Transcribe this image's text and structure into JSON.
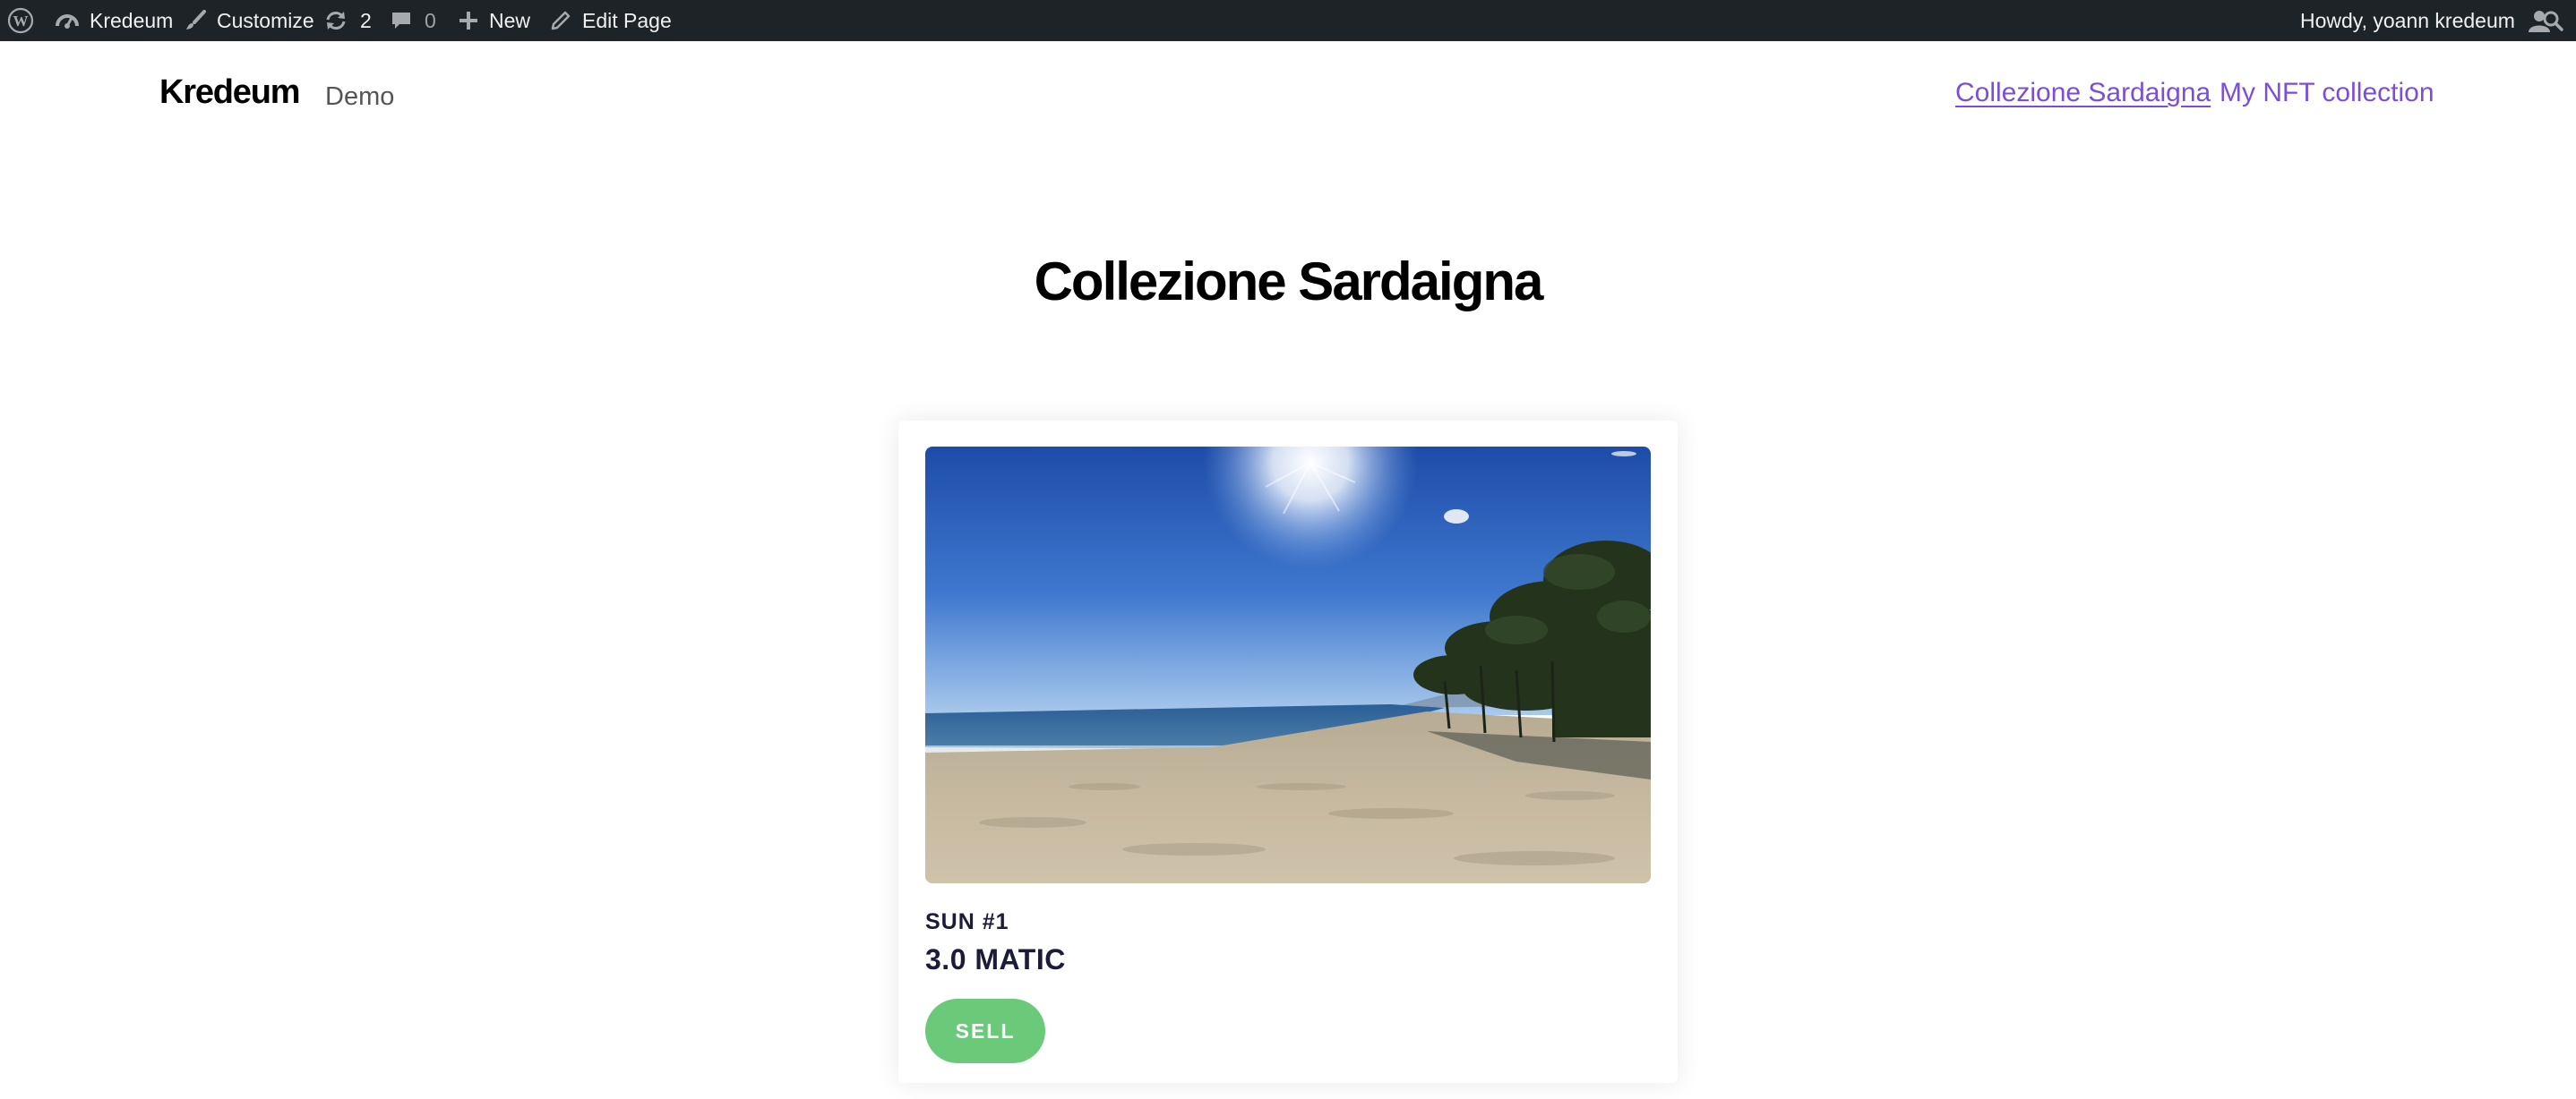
{
  "adminbar": {
    "site_name": "Kredeum",
    "customize_label": "Customize",
    "updates_count": "2",
    "comments_count": "0",
    "new_label": "New",
    "edit_label": "Edit Page",
    "greeting": "Howdy, yoann kredeum",
    "icons": [
      "wordpress-icon",
      "dashboard-icon",
      "brush-icon",
      "updates-icon",
      "comment-icon",
      "plus-icon",
      "pencil-icon",
      "user-icon",
      "search-icon"
    ]
  },
  "header": {
    "site_title": "Kredeum",
    "site_description": "Demo",
    "nav": [
      {
        "label": "Collezione Sardaigna",
        "current": true
      },
      {
        "label": "My NFT collection",
        "current": false
      }
    ]
  },
  "main": {
    "page_title": "Collezione Sardaigna",
    "card": {
      "image_subject": "sandy beach with sea, sun and pine trees",
      "name": "SUN #1",
      "price": "3.0 MATIC",
      "action_label": "SELL"
    }
  },
  "colors": {
    "adminbar_bg": "#1d2327",
    "link": "#7a4fd6",
    "sell_button": "#6bc97a",
    "card_text": "#1c1c3a"
  }
}
